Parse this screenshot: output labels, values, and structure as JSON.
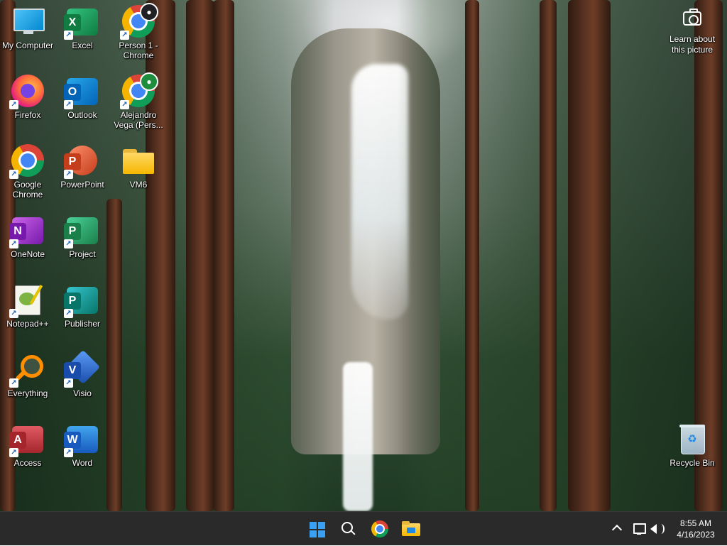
{
  "desktop": {
    "icons": [
      {
        "id": "my-computer",
        "label": "My Computer"
      },
      {
        "id": "excel",
        "label": "Excel",
        "letter": "X"
      },
      {
        "id": "person1-chrome",
        "label": "Person 1 - Chrome"
      },
      {
        "id": "firefox",
        "label": "Firefox"
      },
      {
        "id": "outlook",
        "label": "Outlook",
        "letter": "O"
      },
      {
        "id": "alejandro-chrome",
        "label": "Alejandro Vega (Pers..."
      },
      {
        "id": "google-chrome",
        "label": "Google Chrome"
      },
      {
        "id": "powerpoint",
        "label": "PowerPoint",
        "letter": "P"
      },
      {
        "id": "vm6",
        "label": "VM6"
      },
      {
        "id": "onenote",
        "label": "OneNote",
        "letter": "N"
      },
      {
        "id": "project",
        "label": "Project",
        "letter": "P"
      },
      {
        "id": "notepadpp",
        "label": "Notepad++"
      },
      {
        "id": "publisher",
        "label": "Publisher",
        "letter": "P"
      },
      {
        "id": "everything",
        "label": "Everything"
      },
      {
        "id": "visio",
        "label": "Visio",
        "letter": "V"
      },
      {
        "id": "access",
        "label": "Access",
        "letter": "A"
      },
      {
        "id": "word",
        "label": "Word",
        "letter": "W"
      },
      {
        "id": "recycle-bin",
        "label": "Recycle Bin"
      }
    ],
    "learn_picture": "Learn about this picture"
  },
  "taskbar": {
    "pinned": [
      "start-button",
      "search-button",
      "chrome-button",
      "file-explorer-button"
    ],
    "clock": {
      "time": "8:55 AM",
      "date": "4/16/2023"
    }
  }
}
